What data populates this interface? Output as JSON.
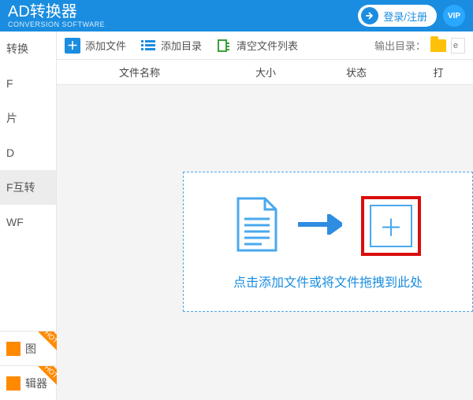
{
  "header": {
    "title": "AD转换器",
    "subtitle": "CONVERSION SOFTWARE",
    "login": "登录/注册",
    "vip": "VIP"
  },
  "sidebar": {
    "items": [
      "转换",
      "F",
      "片",
      "D",
      "F互转",
      "WF"
    ],
    "active_index": 4,
    "bottom": [
      "图",
      "辑器"
    ],
    "hot_label": "HOT"
  },
  "toolbar": {
    "add_file": "添加文件",
    "add_dir": "添加目录",
    "clear": "清空文件列表",
    "output_label": "输出目录：",
    "output_hint": "e"
  },
  "columns": {
    "name": "文件名称",
    "size": "大小",
    "status": "状态",
    "action": "打"
  },
  "drop": {
    "hint": "点击添加文件或将文件拖拽到此处"
  }
}
